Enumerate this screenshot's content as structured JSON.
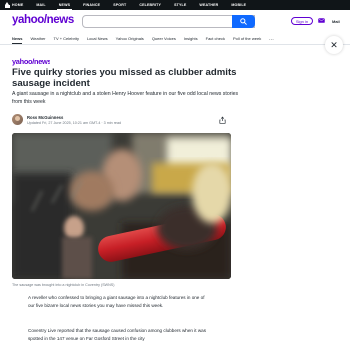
{
  "topbar": {
    "items": [
      "HOME",
      "MAIL",
      "NEWS",
      "FINANCE",
      "SPORT",
      "CELEBRITY",
      "STYLE",
      "WEATHER",
      "MOBILE"
    ],
    "active": "NEWS"
  },
  "header": {
    "logo": "yahoo/news",
    "search_placeholder": "",
    "signin_label": "Sign in",
    "mail_label": "Mail"
  },
  "nav": {
    "items": [
      "News",
      "Weather",
      "TV + Celebrity",
      "Local News",
      "Yahoo Originals",
      "Queer Voices",
      "Insights",
      "Fact check",
      "Poll of the week"
    ],
    "more": "..."
  },
  "article": {
    "headline": "Five quirky stories you missed as clubber admits sausage incident",
    "summary": "A giant sausage in a nightclub and a stolen Henry Hoover feature in our five odd local news stories from this week",
    "author": "Ross McGuinness",
    "meta": "Updated Fri, 27 June 2025, 10:21 am GMT-4  ·  3 min read",
    "caption": "The sausage was brought into a nightclub in Coventry (SWNS)",
    "paragraph1": "A reveller who confessed to bringing a giant sausage into a nightclub features in one of our five bizarre local news stories you may have missed this week.",
    "paragraph2": "Coventry Live reported that the sausage caused confusion among clubbers when it was spotted in the 147 venue on Far Gosford Street in the city"
  },
  "colors": {
    "brand": "#6001d2",
    "search_button": "#0f69ff",
    "topbar": "#101518"
  },
  "icons": [
    "home-icon",
    "search-icon",
    "mail-icon",
    "close-icon",
    "share-icon"
  ]
}
